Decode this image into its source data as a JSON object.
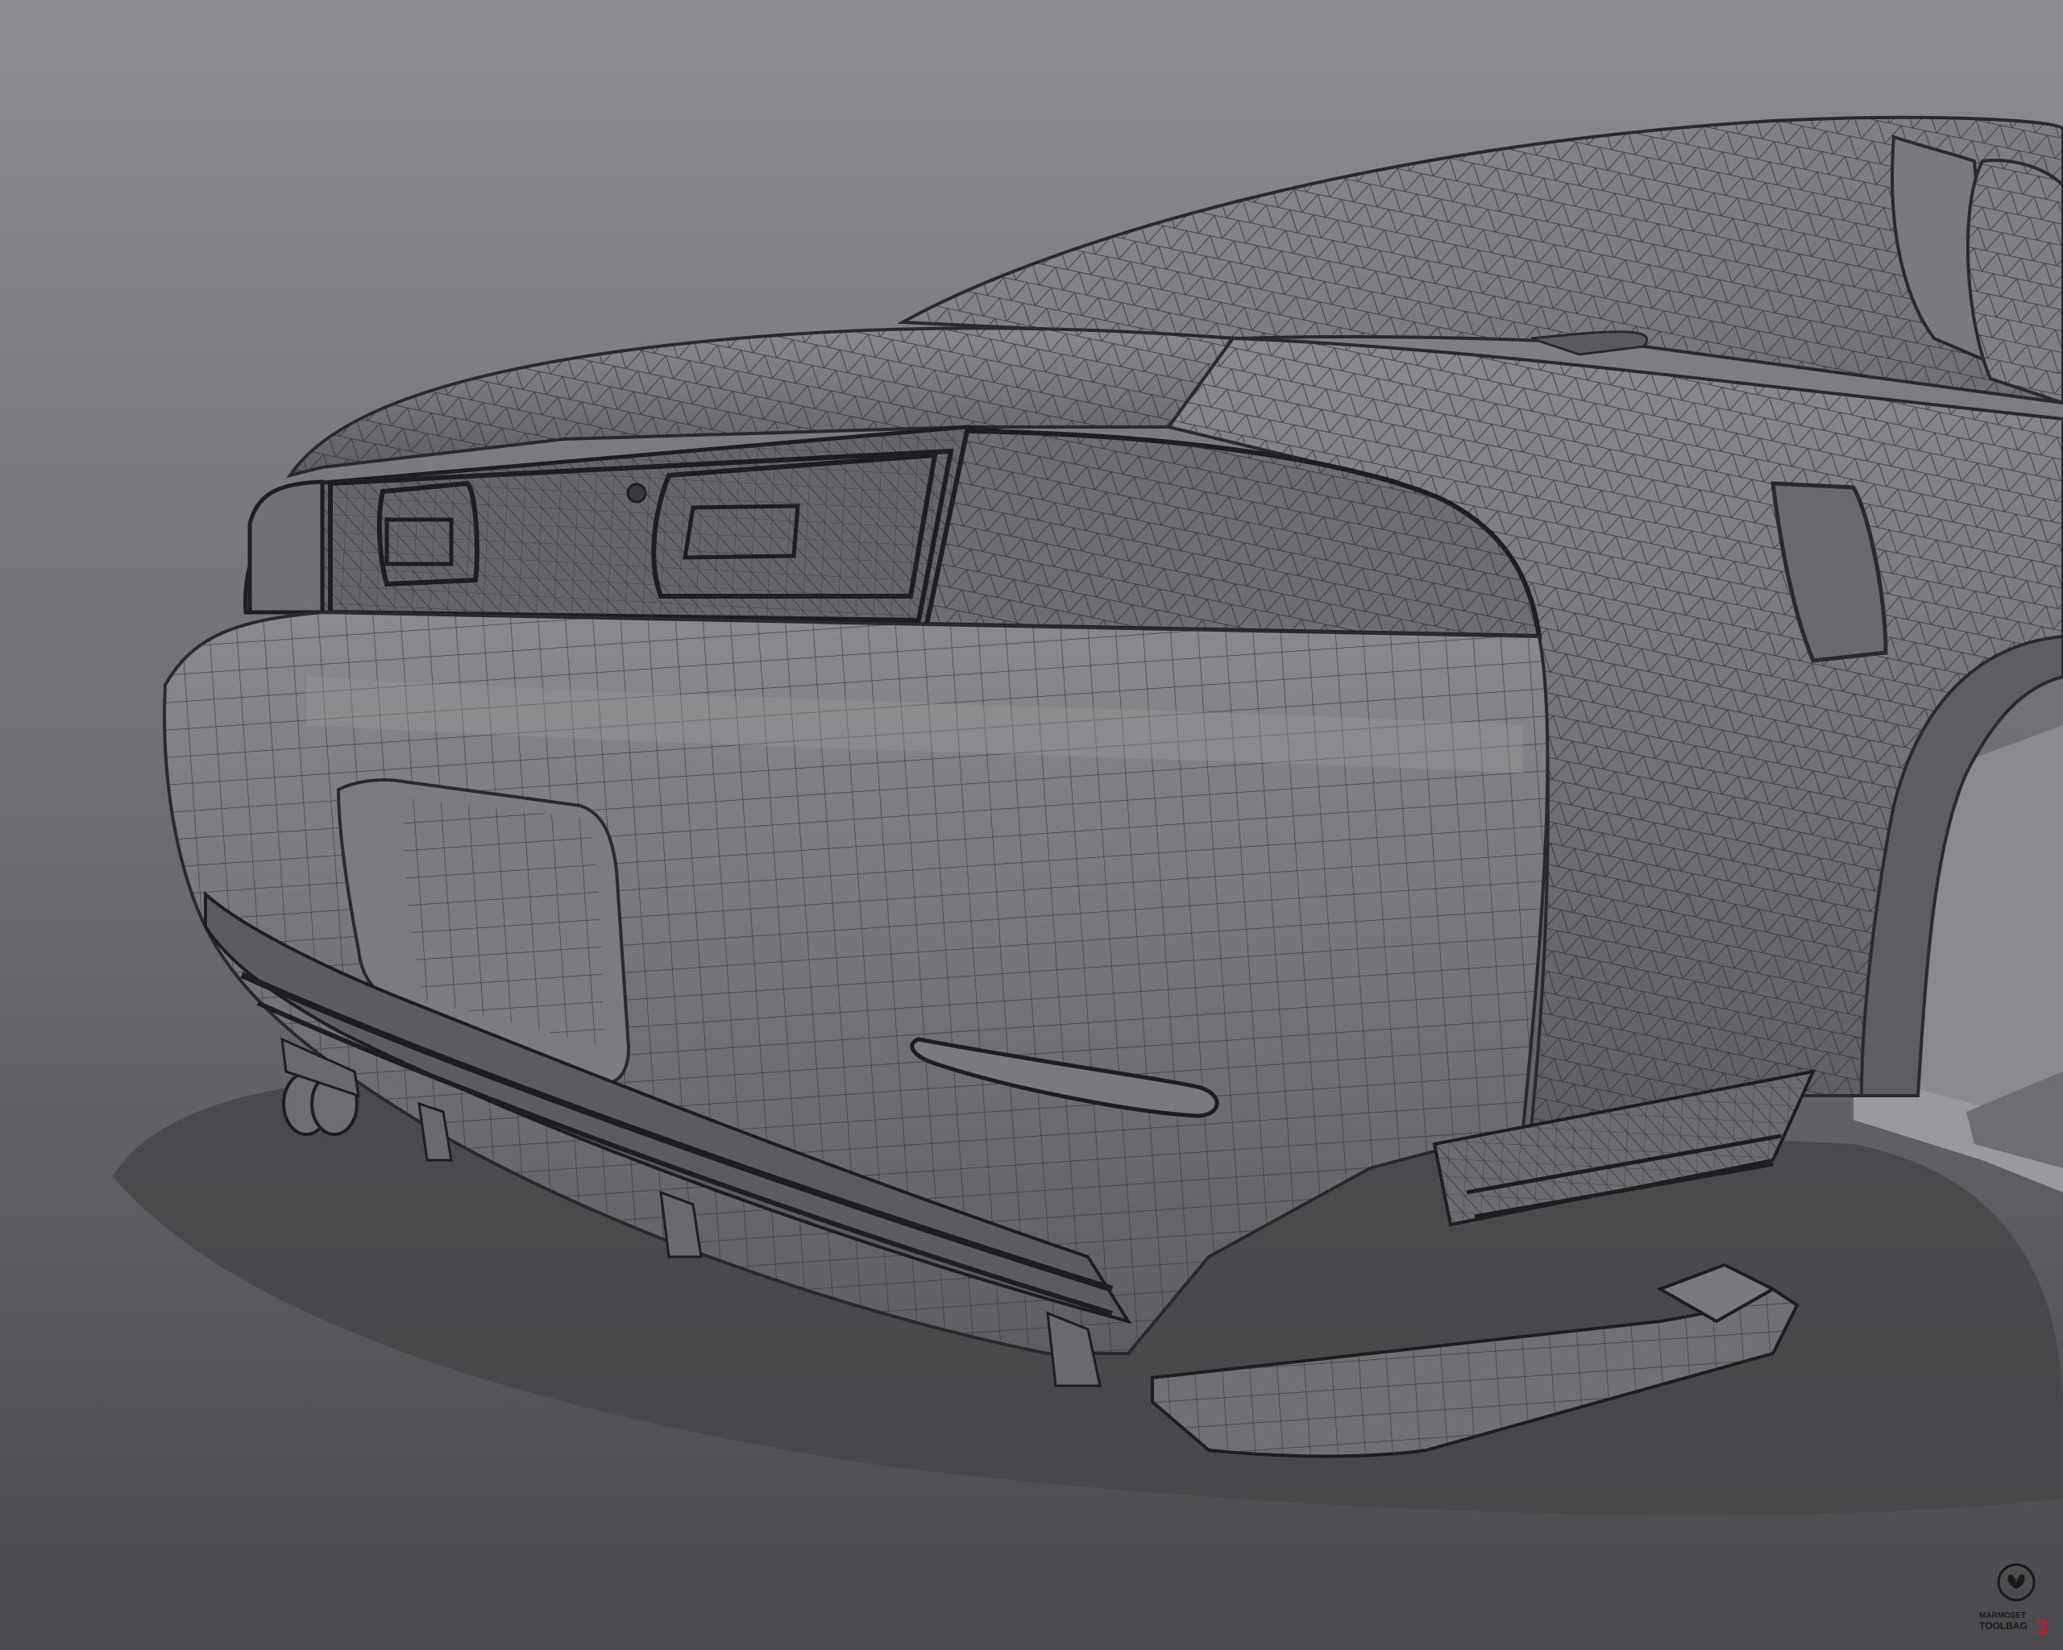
{
  "scene": {
    "subject": "car-rear-wireframe",
    "colors": {
      "background_top": "#8a8a8e",
      "background_bottom": "#4a4a4e",
      "floor": "#4d4d51",
      "shadow": "#3f3f43",
      "body": "#727276",
      "body_light": "#86868a",
      "wire": "#2a2a2e",
      "accent_red": "#c0202a"
    }
  },
  "watermark": {
    "line1": "MARMOSET",
    "line2": "TOOLBAG",
    "version": "3",
    "icon": "marmoset-skull-icon"
  }
}
